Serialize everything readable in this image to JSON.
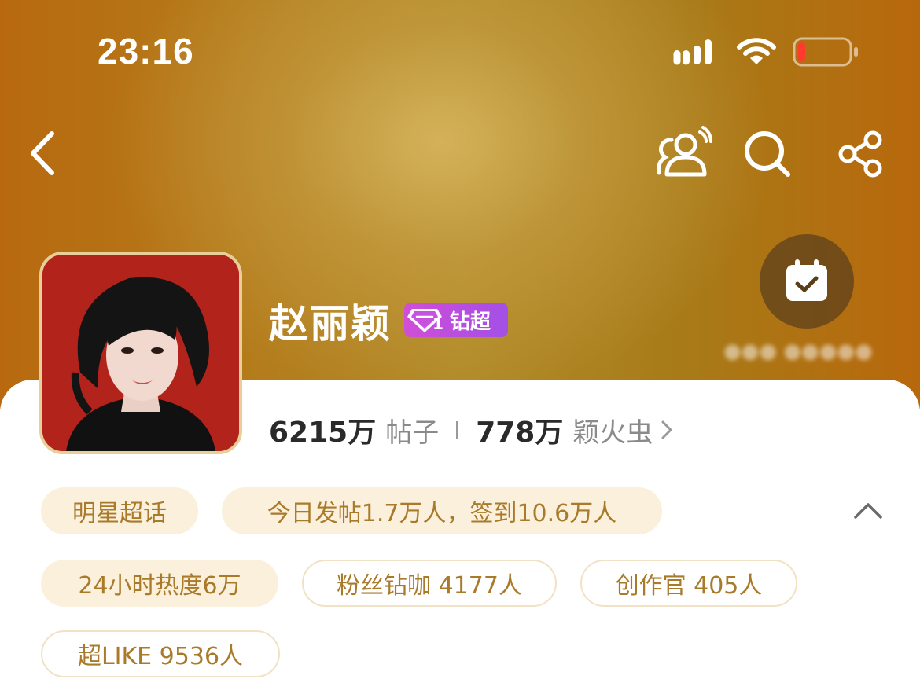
{
  "status_bar": {
    "time": "23:16",
    "battery_color": "#ff3b30"
  },
  "nav": {
    "icons": [
      "back-icon",
      "community-icon",
      "search-icon",
      "share-icon"
    ]
  },
  "header": {
    "title": "赵丽颖",
    "badge": {
      "level": "1",
      "label": "钻超"
    },
    "checkin_icon": "calendar-check-icon"
  },
  "stats": {
    "posts_value": "6215万",
    "posts_label": "帖子",
    "fans_value": "778万",
    "fans_label": "颖火虫"
  },
  "tags": {
    "category": "明星超话",
    "today": "今日发帖1.7万人，签到10.6万人",
    "heat": "24小时热度6万",
    "diamond_fans": "粉丝钻咖 4177人",
    "creators": "创作官 405人",
    "super_like": "超LIKE 9536人"
  },
  "colors": {
    "accent": "#a87a2a",
    "tag_bg": "#fbf0dc",
    "badge": "#b84ee0"
  }
}
